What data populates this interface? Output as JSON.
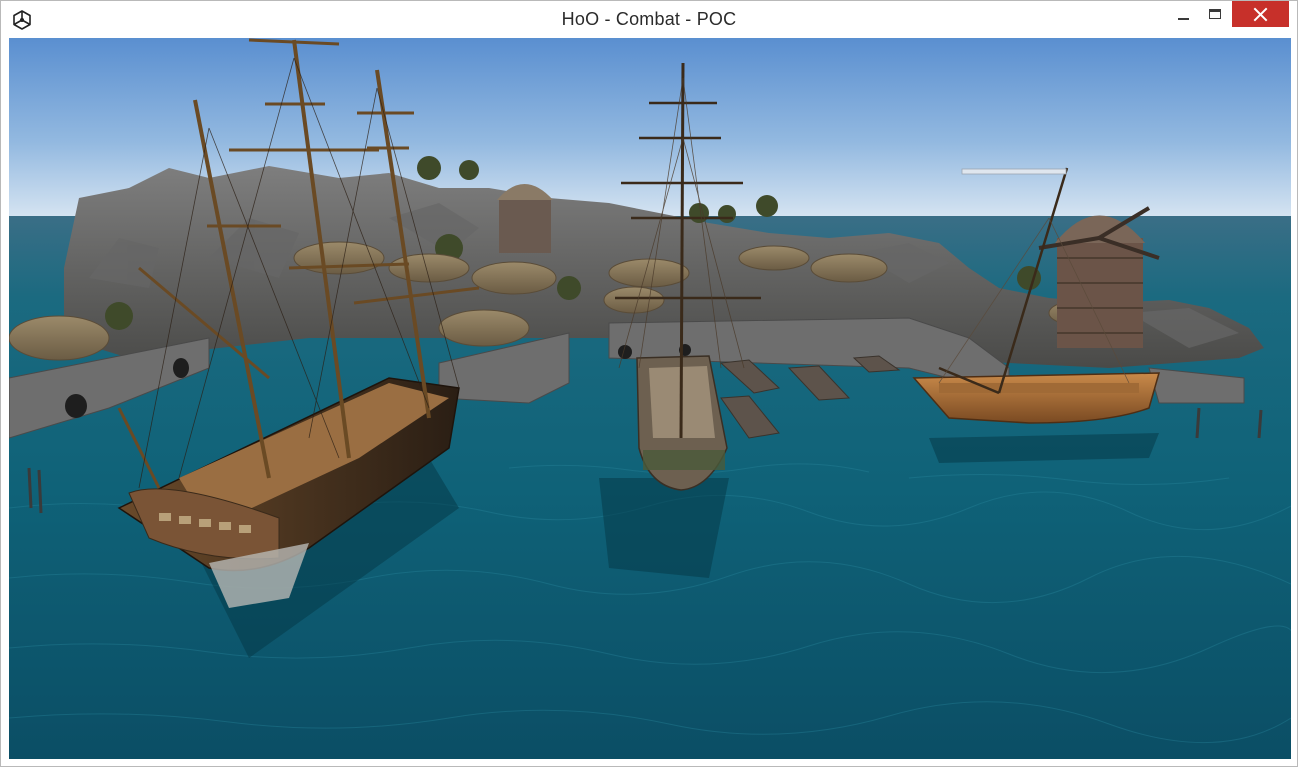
{
  "window": {
    "title": "HoO - Combat - POC",
    "app_icon": "unity-logo-icon",
    "controls": {
      "minimize_icon": "minimize-icon",
      "maximize_icon": "maximize-icon",
      "close_icon": "close-icon"
    },
    "colors": {
      "close_button": "#c7302a",
      "sky_top": "#5a8fd0",
      "sky_horizon": "#d9e8f4",
      "sea": "#0e5e72",
      "sea_near": "#0a4f66"
    }
  },
  "scene": {
    "content": "game-viewport-harbor-scene",
    "overlay_bar_icon": "progress-bar-icon"
  }
}
